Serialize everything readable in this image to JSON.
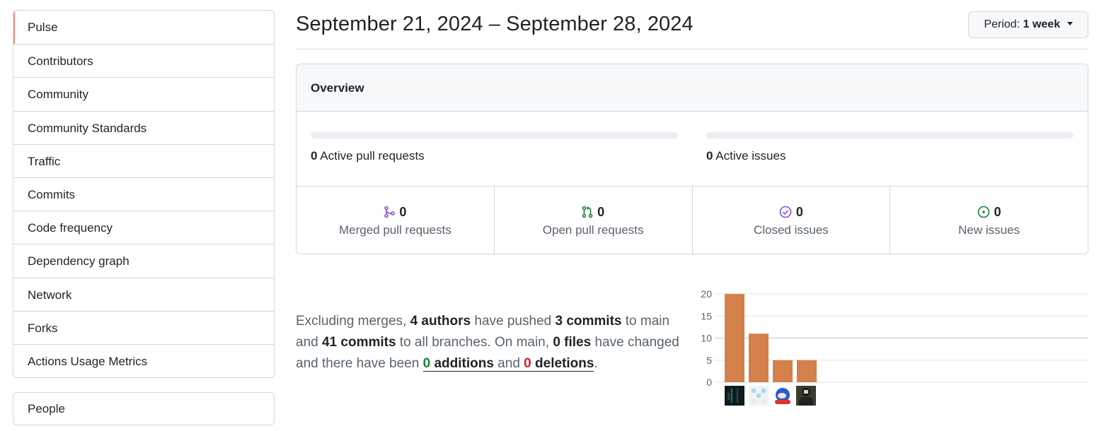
{
  "sidebar": {
    "items": [
      {
        "label": "Pulse"
      },
      {
        "label": "Contributors"
      },
      {
        "label": "Community"
      },
      {
        "label": "Community Standards"
      },
      {
        "label": "Traffic"
      },
      {
        "label": "Commits"
      },
      {
        "label": "Code frequency"
      },
      {
        "label": "Dependency graph"
      },
      {
        "label": "Network"
      },
      {
        "label": "Forks"
      },
      {
        "label": "Actions Usage Metrics"
      }
    ],
    "selected": "Pulse",
    "selected_color": "#fd8c73",
    "people_label": "People"
  },
  "header": {
    "date_range": "September 21, 2024 – September 28, 2024",
    "period_label": "Period:",
    "period_value": "1 week"
  },
  "overview": {
    "title": "Overview",
    "active_prs_count": "0",
    "active_prs_label": "Active pull requests",
    "active_issues_count": "0",
    "active_issues_label": "Active issues",
    "stats": [
      {
        "count": "0",
        "label": "Merged pull requests",
        "icon": "merged-pr-icon",
        "color": "#8250df"
      },
      {
        "count": "0",
        "label": "Open pull requests",
        "icon": "open-pr-icon",
        "color": "#1a7f37"
      },
      {
        "count": "0",
        "label": "Closed issues",
        "icon": "closed-issue-icon",
        "color": "#8250df"
      },
      {
        "count": "0",
        "label": "New issues",
        "icon": "new-issue-icon",
        "color": "#1a7f37"
      }
    ]
  },
  "summary": {
    "t1": "Excluding merges, ",
    "authors": "4 authors",
    "t2": " have pushed ",
    "commits_main": "3 commits",
    "t3": " to main and ",
    "commits_all": "41 commits",
    "t4": " to all branches. On main, ",
    "files": "0 files",
    "t5": " have changed and there have been ",
    "additions_num": "0",
    "additions_word": " additions",
    "t6": " and ",
    "deletions_num": "0",
    "deletions_word": " deletions",
    "t7": "."
  },
  "chart_data": {
    "type": "bar",
    "categories": [
      "author-1",
      "author-2",
      "author-3",
      "author-4"
    ],
    "values": [
      20,
      11,
      5,
      5
    ],
    "ylim": [
      0,
      20
    ],
    "yticks": [
      0,
      5,
      10,
      15,
      20
    ],
    "bar_color": "#d4804a",
    "grid": true
  }
}
